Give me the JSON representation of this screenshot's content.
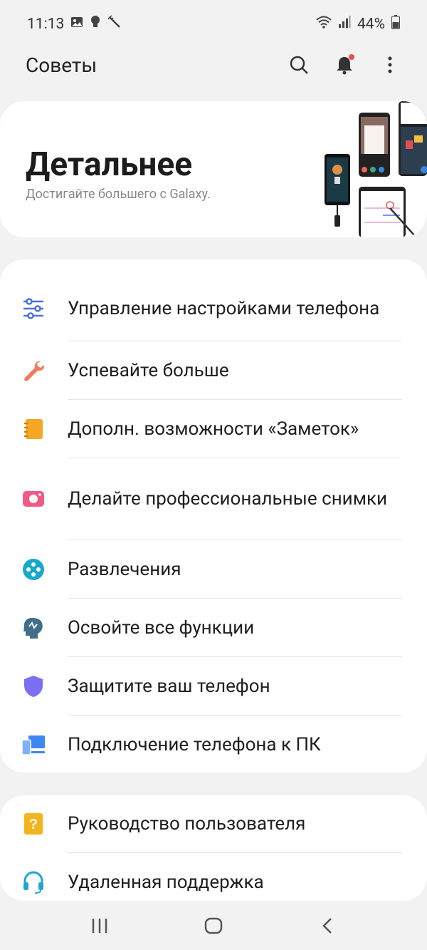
{
  "status_bar": {
    "time": "11:13",
    "battery": "44%",
    "left_icons": [
      "image-icon",
      "bulb-icon",
      "magic-wand-icon"
    ],
    "right_icons": [
      "wifi-icon",
      "signal-icon",
      "battery-icon"
    ]
  },
  "app_bar": {
    "title": "Советы",
    "actions": [
      "search-icon",
      "bell-icon",
      "more-vert-icon"
    ]
  },
  "hero": {
    "title": "Детальнее",
    "subtitle": "Достигайте большего с Galaxy."
  },
  "main_list": [
    {
      "label": "Управление настройками телефона",
      "icon": "sliders-icon",
      "color": "#4f6fd8"
    },
    {
      "label": "Успевайте больше",
      "icon": "wrench-icon",
      "color": "#f27a5e"
    },
    {
      "label": "Дополн. возможности «Заметок»",
      "icon": "notebook-icon",
      "color": "#f5a623"
    },
    {
      "label": "Делайте профессиональные снимки",
      "icon": "camera-icon",
      "color": "#ef5b84"
    },
    {
      "label": "Развлечения",
      "icon": "gamepad-icon",
      "color": "#1aa8c9"
    },
    {
      "label": "Освойте все функции",
      "icon": "head-icon",
      "color": "#3e6e8a"
    },
    {
      "label": "Защитите ваш телефон",
      "icon": "shield-icon",
      "color": "#7b6ef2"
    },
    {
      "label": "Подключение телефона к ПК",
      "icon": "phone-pc-icon",
      "color": "#3e87f0"
    }
  ],
  "secondary_list": [
    {
      "label": "Руководство пользователя",
      "icon": "help-book-icon",
      "color": "#f2b51f"
    },
    {
      "label": "Удаленная поддержка",
      "icon": "headset-icon",
      "color": "#1ea5d6"
    }
  ],
  "nav_bar": {
    "buttons": [
      "recents-icon",
      "home-icon",
      "back-icon"
    ]
  }
}
